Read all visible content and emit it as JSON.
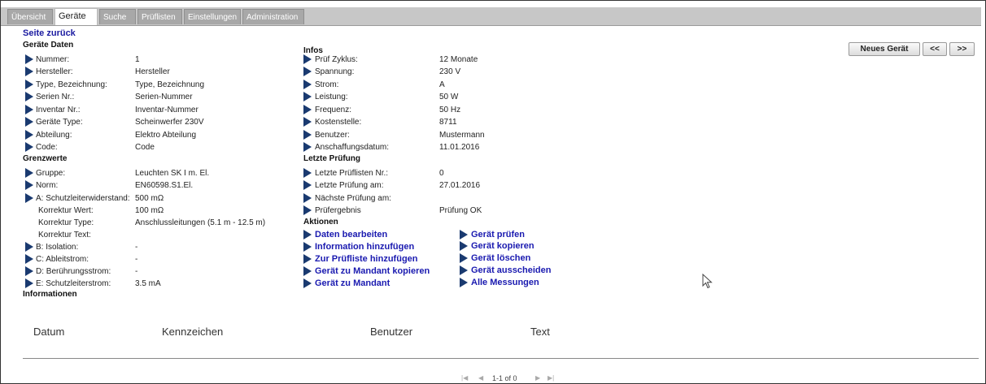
{
  "tabs": [
    {
      "label": "Übersicht",
      "active": false
    },
    {
      "label": "Geräte",
      "active": true
    },
    {
      "label": "Suche",
      "active": false
    },
    {
      "label": "Prüflisten",
      "active": false
    },
    {
      "label": "Einstellungen",
      "active": false
    },
    {
      "label": "Administration",
      "active": false
    }
  ],
  "back_link": "Seite zurück",
  "geraete_daten": {
    "title": "Geräte Daten",
    "rows": [
      {
        "label": "Nummer:",
        "value": "1"
      },
      {
        "label": "Hersteller:",
        "value": "Hersteller"
      },
      {
        "label": "Type, Bezeichnung:",
        "value": "Type, Bezeichnung"
      },
      {
        "label": "Serien Nr.:",
        "value": "Serien-Nummer"
      },
      {
        "label": "Inventar Nr.:",
        "value": "Inventar-Nummer"
      },
      {
        "label": "Geräte Type:",
        "value": "Scheinwerfer 230V"
      },
      {
        "label": "Abteilung:",
        "value": "Elektro Abteilung"
      },
      {
        "label": "Code:",
        "value": "Code"
      }
    ]
  },
  "grenzwerte": {
    "title": "Grenzwerte",
    "rows": [
      {
        "label": "Gruppe:",
        "value": "Leuchten SK I m. El."
      },
      {
        "label": "Norm:",
        "value": "EN60598.S1.El."
      },
      {
        "label": "A: Schutzleiterwiderstand:",
        "value": "500 mΩ"
      },
      {
        "label": "Korrektur Wert:",
        "value": "100 mΩ"
      },
      {
        "label": "Korrektur Type:",
        "value": "Anschlussleitungen (5.1 m - 12.5 m)"
      },
      {
        "label": "Korrektur Text:",
        "value": ""
      },
      {
        "label": "B: Isolation:",
        "value": "-"
      },
      {
        "label": "C: Ableitstrom:",
        "value": "-"
      },
      {
        "label": "D: Berührungsstrom:",
        "value": "-"
      },
      {
        "label": "E: Schutzleiterstrom:",
        "value": "3.5 mA"
      }
    ]
  },
  "informationen_title": "Informationen",
  "infos": {
    "title": "Infos",
    "rows": [
      {
        "label": "Prüf Zyklus:",
        "value": "12 Monate"
      },
      {
        "label": "Spannung:",
        "value": "230 V"
      },
      {
        "label": "Strom:",
        "value": "A"
      },
      {
        "label": "Leistung:",
        "value": "50 W"
      },
      {
        "label": "Frequenz:",
        "value": "50 Hz"
      },
      {
        "label": "Kostenstelle:",
        "value": "8711"
      },
      {
        "label": "Benutzer:",
        "value": "Mustermann"
      },
      {
        "label": "Anschaffungsdatum:",
        "value": "11.01.2016"
      }
    ]
  },
  "letzte_pruefung": {
    "title": "Letzte Prüfung",
    "rows": [
      {
        "label": "Letzte Prüflisten Nr.:",
        "value": "0"
      },
      {
        "label": "Letzte Prüfung am:",
        "value": "27.01.2016"
      },
      {
        "label": "Nächste Prüfung am:",
        "value": ""
      },
      {
        "label": "Prüfergebnis",
        "value": "Prüfung OK"
      }
    ]
  },
  "aktionen": {
    "title": "Aktionen",
    "left": [
      "Daten bearbeiten",
      "Information hinzufügen",
      "Zur Prüfliste hinzufügen",
      "Gerät zu Mandant kopieren",
      "Gerät zu Mandant"
    ],
    "right": [
      "Gerät prüfen",
      "Gerät kopieren",
      "Gerät löschen",
      "Gerät ausscheiden",
      "Alle Messungen"
    ]
  },
  "buttons": {
    "new_device": "Neues Gerät",
    "prev": "<<",
    "next": ">>"
  },
  "table": {
    "headers": [
      "Datum",
      "Kennzeichen",
      "Benutzer",
      "Text"
    ]
  },
  "pager": {
    "text": "1-1 of 0"
  },
  "colors": {
    "link": "#1a1ab0",
    "arrow": "#1a3a70",
    "tabbar": "#c7c7c7"
  },
  "icons": [
    "arrow-right-icon",
    "first-page-icon",
    "prev-page-icon",
    "next-page-icon",
    "last-page-icon",
    "mouse-cursor-icon"
  ]
}
